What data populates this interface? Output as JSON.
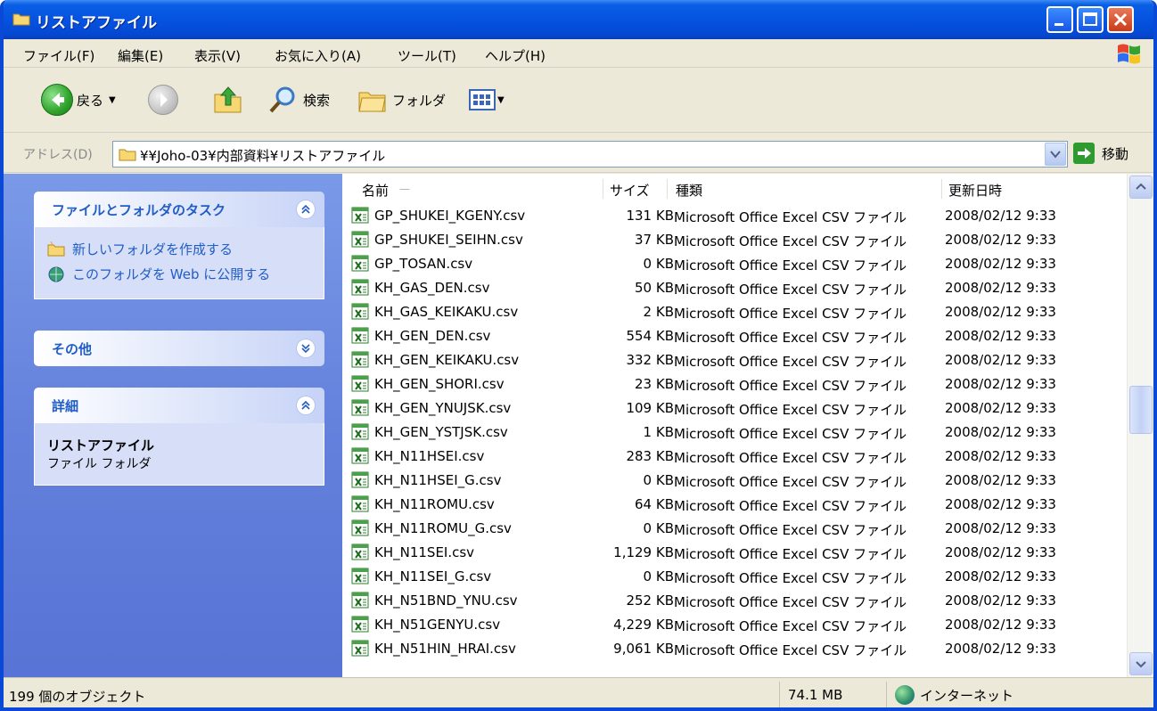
{
  "window": {
    "title": "リストアファイル"
  },
  "menubar": {
    "items": [
      "ファイル(F)",
      "編集(E)",
      "表示(V)",
      "お気に入り(A)",
      "ツール(T)",
      "ヘルプ(H)"
    ]
  },
  "toolbar": {
    "back_label": "戻る",
    "search_label": "検索",
    "folders_label": "フォルダ"
  },
  "address": {
    "label": "アドレス(D)",
    "path": "¥¥Joho-03¥内部資料¥リストアファイル",
    "go_label": "移動"
  },
  "taskpane": {
    "file_tasks": {
      "title": "ファイルとフォルダのタスク",
      "links": [
        "新しいフォルダを作成する",
        "このフォルダを Web に公開する"
      ]
    },
    "other": {
      "title": "その他"
    },
    "details": {
      "title": "詳細",
      "name": "リストアファイル",
      "type": "ファイル フォルダ"
    }
  },
  "filelist": {
    "columns": {
      "name": "名前",
      "size": "サイズ",
      "type": "種類",
      "modified": "更新日時"
    },
    "rows": [
      {
        "name": "GP_SHUKEI_KGENY.csv",
        "size": "131 KB",
        "type": "Microsoft Office Excel CSV ファイル",
        "modified": "2008/02/12 9:33"
      },
      {
        "name": "GP_SHUKEI_SEIHN.csv",
        "size": "37 KB",
        "type": "Microsoft Office Excel CSV ファイル",
        "modified": "2008/02/12 9:33"
      },
      {
        "name": "GP_TOSAN.csv",
        "size": "0 KB",
        "type": "Microsoft Office Excel CSV ファイル",
        "modified": "2008/02/12 9:33"
      },
      {
        "name": "KH_GAS_DEN.csv",
        "size": "50 KB",
        "type": "Microsoft Office Excel CSV ファイル",
        "modified": "2008/02/12 9:33"
      },
      {
        "name": "KH_GAS_KEIKAKU.csv",
        "size": "2 KB",
        "type": "Microsoft Office Excel CSV ファイル",
        "modified": "2008/02/12 9:33"
      },
      {
        "name": "KH_GEN_DEN.csv",
        "size": "554 KB",
        "type": "Microsoft Office Excel CSV ファイル",
        "modified": "2008/02/12 9:33"
      },
      {
        "name": "KH_GEN_KEIKAKU.csv",
        "size": "332 KB",
        "type": "Microsoft Office Excel CSV ファイル",
        "modified": "2008/02/12 9:33"
      },
      {
        "name": "KH_GEN_SHORI.csv",
        "size": "23 KB",
        "type": "Microsoft Office Excel CSV ファイル",
        "modified": "2008/02/12 9:33"
      },
      {
        "name": "KH_GEN_YNUJSK.csv",
        "size": "109 KB",
        "type": "Microsoft Office Excel CSV ファイル",
        "modified": "2008/02/12 9:33"
      },
      {
        "name": "KH_GEN_YSTJSK.csv",
        "size": "1 KB",
        "type": "Microsoft Office Excel CSV ファイル",
        "modified": "2008/02/12 9:33"
      },
      {
        "name": "KH_N11HSEI.csv",
        "size": "283 KB",
        "type": "Microsoft Office Excel CSV ファイル",
        "modified": "2008/02/12 9:33"
      },
      {
        "name": "KH_N11HSEI_G.csv",
        "size": "0 KB",
        "type": "Microsoft Office Excel CSV ファイル",
        "modified": "2008/02/12 9:33"
      },
      {
        "name": "KH_N11ROMU.csv",
        "size": "64 KB",
        "type": "Microsoft Office Excel CSV ファイル",
        "modified": "2008/02/12 9:33"
      },
      {
        "name": "KH_N11ROMU_G.csv",
        "size": "0 KB",
        "type": "Microsoft Office Excel CSV ファイル",
        "modified": "2008/02/12 9:33"
      },
      {
        "name": "KH_N11SEI.csv",
        "size": "1,129 KB",
        "type": "Microsoft Office Excel CSV ファイル",
        "modified": "2008/02/12 9:33"
      },
      {
        "name": "KH_N11SEI_G.csv",
        "size": "0 KB",
        "type": "Microsoft Office Excel CSV ファイル",
        "modified": "2008/02/12 9:33"
      },
      {
        "name": "KH_N51BND_YNU.csv",
        "size": "252 KB",
        "type": "Microsoft Office Excel CSV ファイル",
        "modified": "2008/02/12 9:33"
      },
      {
        "name": "KH_N51GENYU.csv",
        "size": "4,229 KB",
        "type": "Microsoft Office Excel CSV ファイル",
        "modified": "2008/02/12 9:33"
      },
      {
        "name": "KH_N51HIN_HRAI.csv",
        "size": "9,061 KB",
        "type": "Microsoft Office Excel CSV ファイル",
        "modified": "2008/02/12 9:33"
      }
    ]
  },
  "statusbar": {
    "count": "199 個のオブジェクト",
    "size": "74.1 MB",
    "zone": "インターネット"
  },
  "colors": {
    "titlebar": "#0553df",
    "taskpane": "#6481dc",
    "link": "#215dc6"
  }
}
